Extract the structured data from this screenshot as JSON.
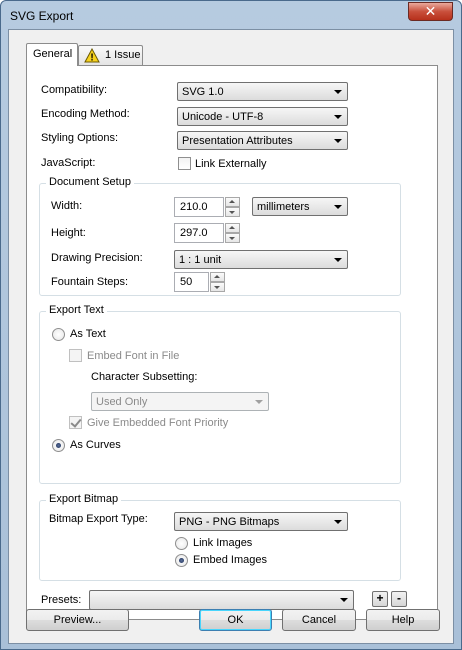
{
  "window": {
    "title": "SVG Export",
    "close_glyph": "✕"
  },
  "tabs": [
    {
      "label": "General"
    },
    {
      "label": "1 Issue",
      "icon": "warning-icon",
      "icon_glyph": "!"
    }
  ],
  "general": {
    "compatibility_label": "Compatibility:",
    "compatibility_value": "SVG 1.0",
    "encoding_label": "Encoding Method:",
    "encoding_value": "Unicode - UTF-8",
    "styling_label": "Styling Options:",
    "styling_value": "Presentation Attributes",
    "javascript_label": "JavaScript:",
    "link_externally_label": "Link Externally",
    "link_externally_checked": false
  },
  "document_setup": {
    "title": "Document Setup",
    "width_label": "Width:",
    "width_value": "210.0",
    "units_value": "millimeters",
    "height_label": "Height:",
    "height_value": "297.0",
    "precision_label": "Drawing Precision:",
    "precision_value": "1 : 1 unit",
    "fountain_label": "Fountain Steps:",
    "fountain_value": "50"
  },
  "export_text": {
    "title": "Export Text",
    "as_text_label": "As Text",
    "as_text_selected": false,
    "embed_font_label": "Embed Font in File",
    "embed_font_checked": false,
    "char_subsetting_label": "Character Subsetting:",
    "char_subsetting_value": "Used Only",
    "give_priority_label": "Give Embedded Font Priority",
    "give_priority_checked": true,
    "as_curves_label": "As Curves",
    "as_curves_selected": true
  },
  "export_bitmap": {
    "title": "Export Bitmap",
    "type_label": "Bitmap Export Type:",
    "type_value": "PNG - PNG Bitmaps",
    "link_images_label": "Link Images",
    "link_images_selected": false,
    "embed_images_label": "Embed Images",
    "embed_images_selected": true
  },
  "presets": {
    "label": "Presets:",
    "value": "",
    "add_glyph": "+",
    "remove_glyph": "-"
  },
  "footer": {
    "preview_label": "Preview...",
    "ok_label": "OK",
    "cancel_label": "Cancel",
    "help_label": "Help"
  },
  "colors": {
    "frame": "#a9c0d8",
    "close_button": "#c9503c",
    "default_button_border": "#3c7fb1"
  }
}
